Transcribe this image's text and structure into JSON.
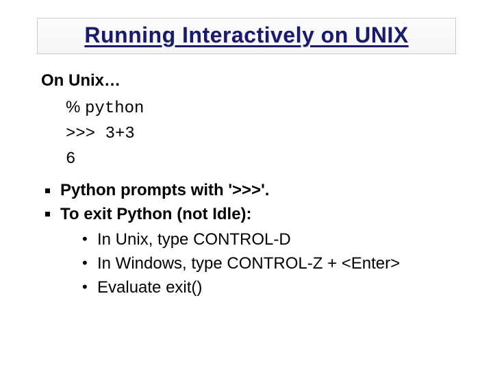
{
  "title": "Running Interactively on UNIX",
  "intro": "On Unix…",
  "code": {
    "line1_prefix": "% ",
    "line1_cmd": "python",
    "line2": ">>> 3+3",
    "line3": "6"
  },
  "bullets": {
    "b1": "Python prompts with '>>>'.",
    "b2": "To exit Python (not Idle):",
    "sub": {
      "s1": "In Unix, type CONTROL-D",
      "s2": "In Windows, type CONTROL-Z + <Enter>",
      "s3": "Evaluate exit()"
    }
  }
}
